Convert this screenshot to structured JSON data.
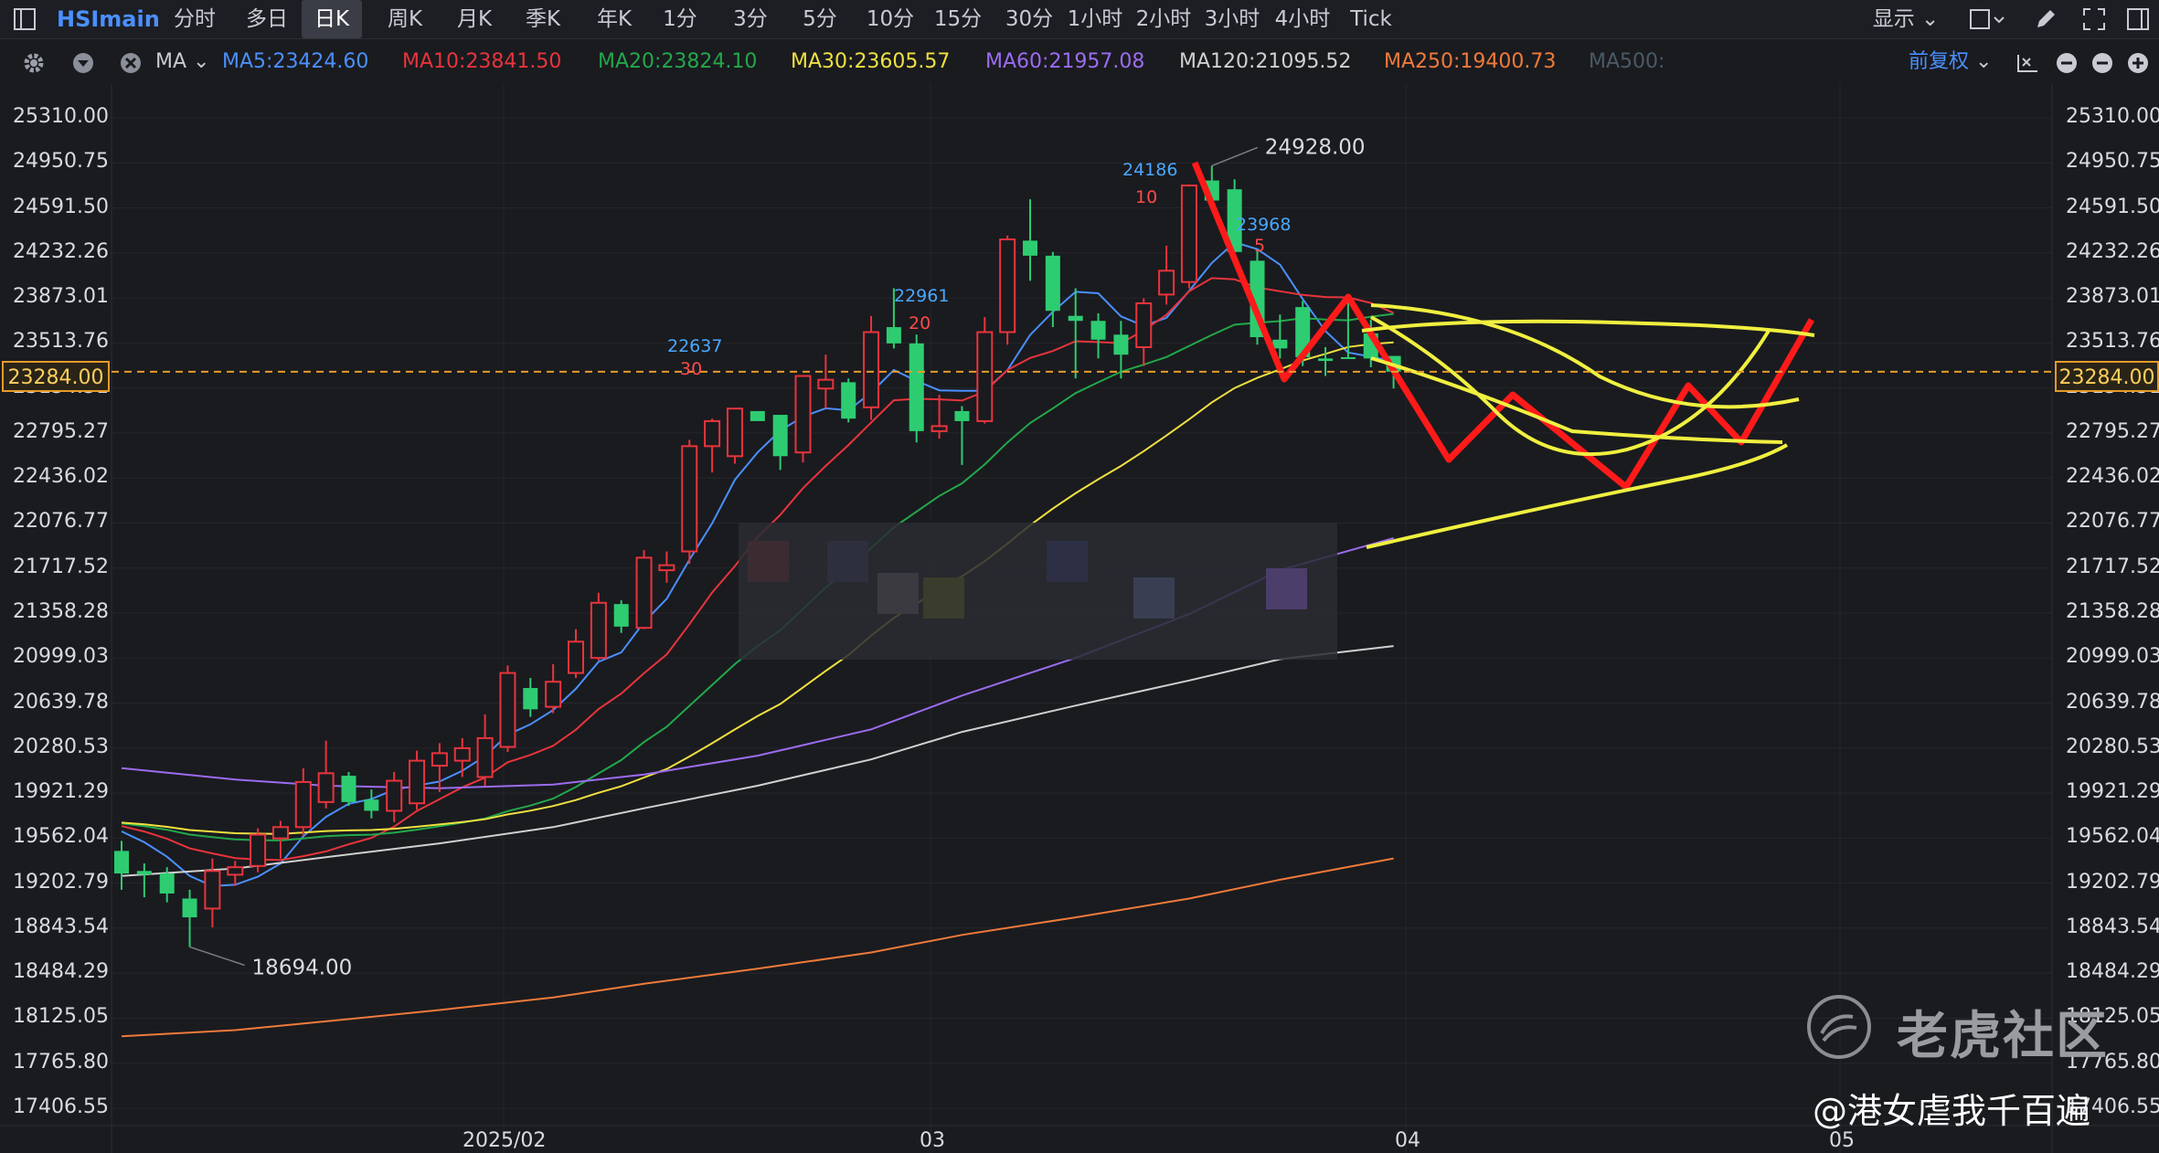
{
  "toolbar": {
    "symbol": "HSImain",
    "periods": [
      "分时",
      "多日",
      "日K",
      "周K",
      "月K",
      "季K",
      "年K",
      "1分",
      "3分",
      "5分",
      "10分",
      "15分",
      "30分",
      "1小时",
      "2小时",
      "3小时",
      "4小时",
      "Tick"
    ],
    "active_period": "日K",
    "display_label": "显示"
  },
  "ma_bar": {
    "ma_label": "MA",
    "items": [
      {
        "text": "MA5:23424.60",
        "color": "#4a90ff"
      },
      {
        "text": "MA10:23841.50",
        "color": "#e8343c"
      },
      {
        "text": "MA20:23824.10",
        "color": "#22a84a"
      },
      {
        "text": "MA30:23605.57",
        "color": "#f0e040"
      },
      {
        "text": "MA60:21957.08",
        "color": "#9b6cf0"
      },
      {
        "text": "MA120:21095.52",
        "color": "#d0d0d0"
      },
      {
        "text": "MA250:19400.73",
        "color": "#f07a3a"
      },
      {
        "text": "MA500:",
        "color": "#4a5a66"
      }
    ],
    "adjust_label": "前复权"
  },
  "chart_data": {
    "type": "candlestick",
    "y_ticks": [
      "25310.00",
      "24950.75",
      "24591.50",
      "24232.26",
      "23873.01",
      "23513.76",
      "23154.51",
      "22795.27",
      "22436.02",
      "22076.77",
      "21717.52",
      "21358.28",
      "20999.03",
      "20639.78",
      "20280.53",
      "19921.29",
      "19562.04",
      "19202.79",
      "18843.54",
      "18484.29",
      "18125.05",
      "17765.80",
      "17406.55"
    ],
    "ylim": [
      17406.55,
      25310.0
    ],
    "x_labels": [
      "2025/02",
      "03",
      "04",
      "05"
    ],
    "current_price": "23284.00",
    "annotations": {
      "high": "24928.00",
      "low": "18694.00",
      "ma_labels": [
        {
          "text": "24186",
          "color": "#4aa8ff"
        },
        {
          "text": "10",
          "color": "#ff4a4a"
        },
        {
          "text": "23968",
          "color": "#4aa8ff"
        },
        {
          "text": "5",
          "color": "#ff4a4a"
        },
        {
          "text": "22961",
          "color": "#4aa8ff"
        },
        {
          "text": "20",
          "color": "#ff4a4a"
        },
        {
          "text": "22637",
          "color": "#4aa8ff"
        },
        {
          "text": "30",
          "color": "#ff4a4a"
        }
      ]
    },
    "candles": [
      {
        "o": 19460,
        "h": 19540,
        "l": 19150,
        "c": 19280
      },
      {
        "o": 19300,
        "h": 19360,
        "l": 19090,
        "c": 19270
      },
      {
        "o": 19280,
        "h": 19330,
        "l": 19050,
        "c": 19120
      },
      {
        "o": 19080,
        "h": 19150,
        "l": 18694,
        "c": 18930
      },
      {
        "o": 19000,
        "h": 19400,
        "l": 18850,
        "c": 19300
      },
      {
        "o": 19270,
        "h": 19380,
        "l": 19180,
        "c": 19330
      },
      {
        "o": 19340,
        "h": 19640,
        "l": 19290,
        "c": 19590
      },
      {
        "o": 19560,
        "h": 19700,
        "l": 19400,
        "c": 19650
      },
      {
        "o": 19650,
        "h": 20120,
        "l": 19580,
        "c": 20010
      },
      {
        "o": 19850,
        "h": 20340,
        "l": 19800,
        "c": 20080
      },
      {
        "o": 20060,
        "h": 20090,
        "l": 19820,
        "c": 19850
      },
      {
        "o": 19870,
        "h": 19950,
        "l": 19720,
        "c": 19780
      },
      {
        "o": 19780,
        "h": 20090,
        "l": 19690,
        "c": 20020
      },
      {
        "o": 19840,
        "h": 20260,
        "l": 19790,
        "c": 20180
      },
      {
        "o": 20140,
        "h": 20320,
        "l": 19930,
        "c": 20240
      },
      {
        "o": 20180,
        "h": 20360,
        "l": 20050,
        "c": 20280
      },
      {
        "o": 20050,
        "h": 20550,
        "l": 19980,
        "c": 20360
      },
      {
        "o": 20290,
        "h": 20940,
        "l": 20250,
        "c": 20880
      },
      {
        "o": 20760,
        "h": 20840,
        "l": 20530,
        "c": 20590
      },
      {
        "o": 20610,
        "h": 20950,
        "l": 20560,
        "c": 20810
      },
      {
        "o": 20880,
        "h": 21230,
        "l": 20840,
        "c": 21130
      },
      {
        "o": 21000,
        "h": 21520,
        "l": 20980,
        "c": 21440
      },
      {
        "o": 21430,
        "h": 21460,
        "l": 21200,
        "c": 21250
      },
      {
        "o": 21240,
        "h": 21860,
        "l": 21230,
        "c": 21800
      },
      {
        "o": 21700,
        "h": 21850,
        "l": 21600,
        "c": 21740
      },
      {
        "o": 21850,
        "h": 22740,
        "l": 21750,
        "c": 22690
      },
      {
        "o": 22690,
        "h": 22910,
        "l": 22480,
        "c": 22890
      },
      {
        "o": 22610,
        "h": 22980,
        "l": 22550,
        "c": 22990
      },
      {
        "o": 22970,
        "h": 22940,
        "l": 22900,
        "c": 22890
      },
      {
        "o": 22940,
        "h": 22920,
        "l": 22500,
        "c": 22610
      },
      {
        "o": 22640,
        "h": 23250,
        "l": 22560,
        "c": 23250
      },
      {
        "o": 23150,
        "h": 23420,
        "l": 22990,
        "c": 23220
      },
      {
        "o": 23200,
        "h": 23230,
        "l": 22880,
        "c": 22910
      },
      {
        "o": 23000,
        "h": 23730,
        "l": 22900,
        "c": 23600
      },
      {
        "o": 23640,
        "h": 23950,
        "l": 23470,
        "c": 23510
      },
      {
        "o": 23510,
        "h": 23580,
        "l": 22720,
        "c": 22810
      },
      {
        "o": 22810,
        "h": 23100,
        "l": 22750,
        "c": 22850
      },
      {
        "o": 22970,
        "h": 23010,
        "l": 22540,
        "c": 22890
      },
      {
        "o": 22890,
        "h": 23720,
        "l": 22870,
        "c": 23600
      },
      {
        "o": 23600,
        "h": 24370,
        "l": 23500,
        "c": 24340
      },
      {
        "o": 24330,
        "h": 24660,
        "l": 24010,
        "c": 24210
      },
      {
        "o": 24210,
        "h": 24240,
        "l": 23640,
        "c": 23770
      },
      {
        "o": 23730,
        "h": 23950,
        "l": 23230,
        "c": 23690
      },
      {
        "o": 23690,
        "h": 23750,
        "l": 23390,
        "c": 23540
      },
      {
        "o": 23580,
        "h": 23690,
        "l": 23230,
        "c": 23420
      },
      {
        "o": 23480,
        "h": 23870,
        "l": 23330,
        "c": 23830
      },
      {
        "o": 23900,
        "h": 24290,
        "l": 23820,
        "c": 24090
      },
      {
        "o": 24000,
        "h": 24780,
        "l": 23950,
        "c": 24770
      },
      {
        "o": 24810,
        "h": 24928,
        "l": 24580,
        "c": 24650
      },
      {
        "o": 24740,
        "h": 24820,
        "l": 24230,
        "c": 24240
      },
      {
        "o": 24170,
        "h": 24260,
        "l": 23500,
        "c": 23560
      },
      {
        "o": 23540,
        "h": 23740,
        "l": 23390,
        "c": 23470
      },
      {
        "o": 23800,
        "h": 23850,
        "l": 23330,
        "c": 23400
      },
      {
        "o": 23390,
        "h": 23480,
        "l": 23250,
        "c": 23370
      },
      {
        "o": 23400,
        "h": 23850,
        "l": 23390,
        "c": 23390
      },
      {
        "o": 23590,
        "h": 23700,
        "l": 23320,
        "c": 23390
      },
      {
        "o": 23410,
        "h": 23410,
        "l": 23150,
        "c": 23284
      }
    ]
  },
  "watermark": {
    "brand": "老虎社区",
    "author": "@港女虐我千百遍"
  }
}
